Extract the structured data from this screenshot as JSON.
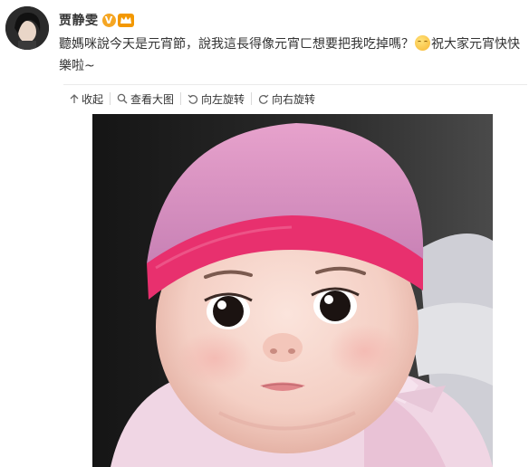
{
  "author": {
    "name": "贾静雯",
    "verified_badge_letter": "V"
  },
  "post": {
    "line1": "聽媽咪說今天是元宵節，說我這長得像元宵ㄈ想要把我吃掉嗎？",
    "line2": "祝大家元宵快快樂啦~"
  },
  "toolbar": {
    "collapse_label": "收起",
    "view_large_label": "查看大图",
    "rotate_left_label": "向左旋转",
    "rotate_right_label": "向右旋转"
  },
  "icons": {
    "collapse": "arrow-up-icon",
    "view_large": "magnifier-icon",
    "rotate_left": "rotate-left-icon",
    "rotate_right": "rotate-right-icon",
    "emoji": "smile-emoji-icon"
  },
  "colors": {
    "hat_pink": "#e8306e",
    "badge_orange": "#f5a623"
  }
}
